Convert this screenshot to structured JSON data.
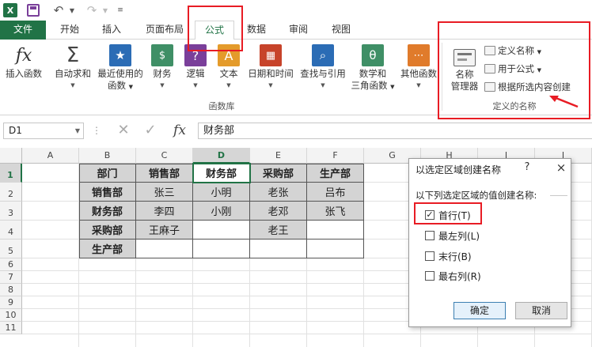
{
  "quick_access": {
    "app_logo": "X",
    "icons": [
      "excel-logo",
      "save-icon",
      "undo-icon",
      "redo-icon"
    ]
  },
  "tabs": {
    "file": "文件",
    "home": "开始",
    "insert": "插入",
    "layout": "页面布局",
    "formula": "公式",
    "data": "数据",
    "review": "审阅",
    "view": "视图"
  },
  "ribbon": {
    "library": {
      "insert_function": "插入函数",
      "autosum": "自动求和",
      "recent_1": "最近使用的",
      "recent_2": "函数",
      "financial": "财务",
      "logical": "逻辑",
      "text": "文本",
      "datetime": "日期和时间",
      "lookup": "查找与引用",
      "math_1": "数学和",
      "math_2": "三角函数",
      "more": "其他函数",
      "group_label": "函数库"
    },
    "names": {
      "manager_1": "名称",
      "manager_2": "管理器",
      "define": "定义名称",
      "use_in_formula": "用于公式",
      "create_from_selection": "根据所选内容创建",
      "group_label": "定义的名称"
    }
  },
  "formula_bar": {
    "name_box": "D1",
    "content": "财务部"
  },
  "grid": {
    "columns": [
      "A",
      "B",
      "C",
      "D",
      "E",
      "F",
      "G",
      "H",
      "I",
      "J"
    ],
    "rows": [
      "1",
      "2",
      "3",
      "4",
      "5",
      "6",
      "7",
      "8",
      "9",
      "10",
      "11"
    ],
    "table": [
      [
        "部门",
        "销售部",
        "财务部",
        "采购部",
        "生产部"
      ],
      [
        "销售部",
        "张三",
        "小明",
        "老张",
        "吕布"
      ],
      [
        "财务部",
        "李四",
        "小刚",
        "老邓",
        "张飞"
      ],
      [
        "采购部",
        "王麻子",
        "",
        "老王",
        ""
      ],
      [
        "生产部",
        "",
        "",
        "",
        ""
      ]
    ]
  },
  "dialog": {
    "title": "以选定区域创建名称",
    "help": "?",
    "close": "×",
    "prompt": "以下列选定区域的值创建名称:",
    "options": [
      {
        "label": "首行(T)",
        "checked": true
      },
      {
        "label": "最左列(L)",
        "checked": false
      },
      {
        "label": "末行(B)",
        "checked": false
      },
      {
        "label": "最右列(R)",
        "checked": false
      }
    ],
    "ok": "确定",
    "cancel": "取消"
  },
  "colors": {
    "excel_green": "#217346",
    "annotation_red": "#e81c24",
    "cell_gray": "#d4d4d4"
  }
}
